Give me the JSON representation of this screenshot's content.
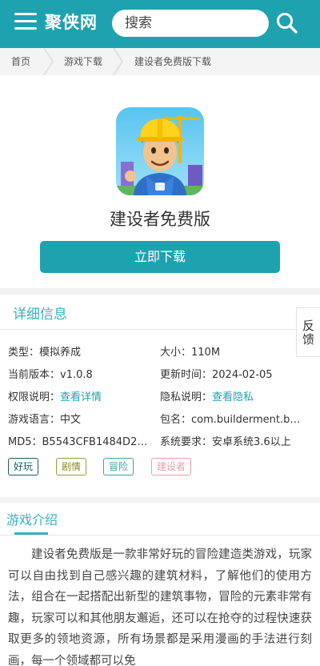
{
  "header": {
    "logo": "聚侠网",
    "search_placeholder": "搜索",
    "icons": {
      "menu": "menu-icon",
      "search": "search-icon"
    }
  },
  "breadcrumb": [
    "首页",
    "游戏下载",
    "建设者免费版下载"
  ],
  "app": {
    "name": "建设者免费版",
    "download_label": "立即下载"
  },
  "detail": {
    "title": "详细信息",
    "rows": [
      {
        "label": "类型：",
        "value": "模拟养成"
      },
      {
        "label": "大小：",
        "value": "110M"
      },
      {
        "label": "当前版本：",
        "value": "v1.0.8"
      },
      {
        "label": "更新时间：",
        "value": "2024-02-05"
      },
      {
        "label": "权限说明：",
        "value": "查看详情"
      },
      {
        "label": "隐私说明：",
        "value": "查看隐私"
      },
      {
        "label": "游戏语言：",
        "value": "中文"
      },
      {
        "label": "包名：",
        "value": "com.builderment.b…"
      },
      {
        "label": "MD5：",
        "value": "B5543CFB1484D2…"
      },
      {
        "label": "系统要求：",
        "value": "安卓系统3.6以上"
      }
    ],
    "tags": [
      "好玩",
      "剧情",
      "冒险",
      "建设者"
    ]
  },
  "feedback_label": "反馈",
  "intro": {
    "title": "游戏介绍",
    "text": "建设者免费版是一款非常好玩的冒险建造类游戏，玩家可以自由找到自己感兴趣的建筑材料，了解他们的使用方法，组合在一起搭配出新型的建筑事物，冒险的元素非常有趣，玩家可以和其他朋友邂逅，还可以在抢夺的过程快速获取更多的领地资源，所有场景都是采用漫画的手法进行刻画，每一个领域都可以免"
  },
  "colors": {
    "brand": "#1ea2b0",
    "section_title": "#39b0bf",
    "tag_colors": [
      "#1a5c66",
      "#8a8a2a",
      "#3aa3a8",
      "#e8a0a6"
    ]
  }
}
